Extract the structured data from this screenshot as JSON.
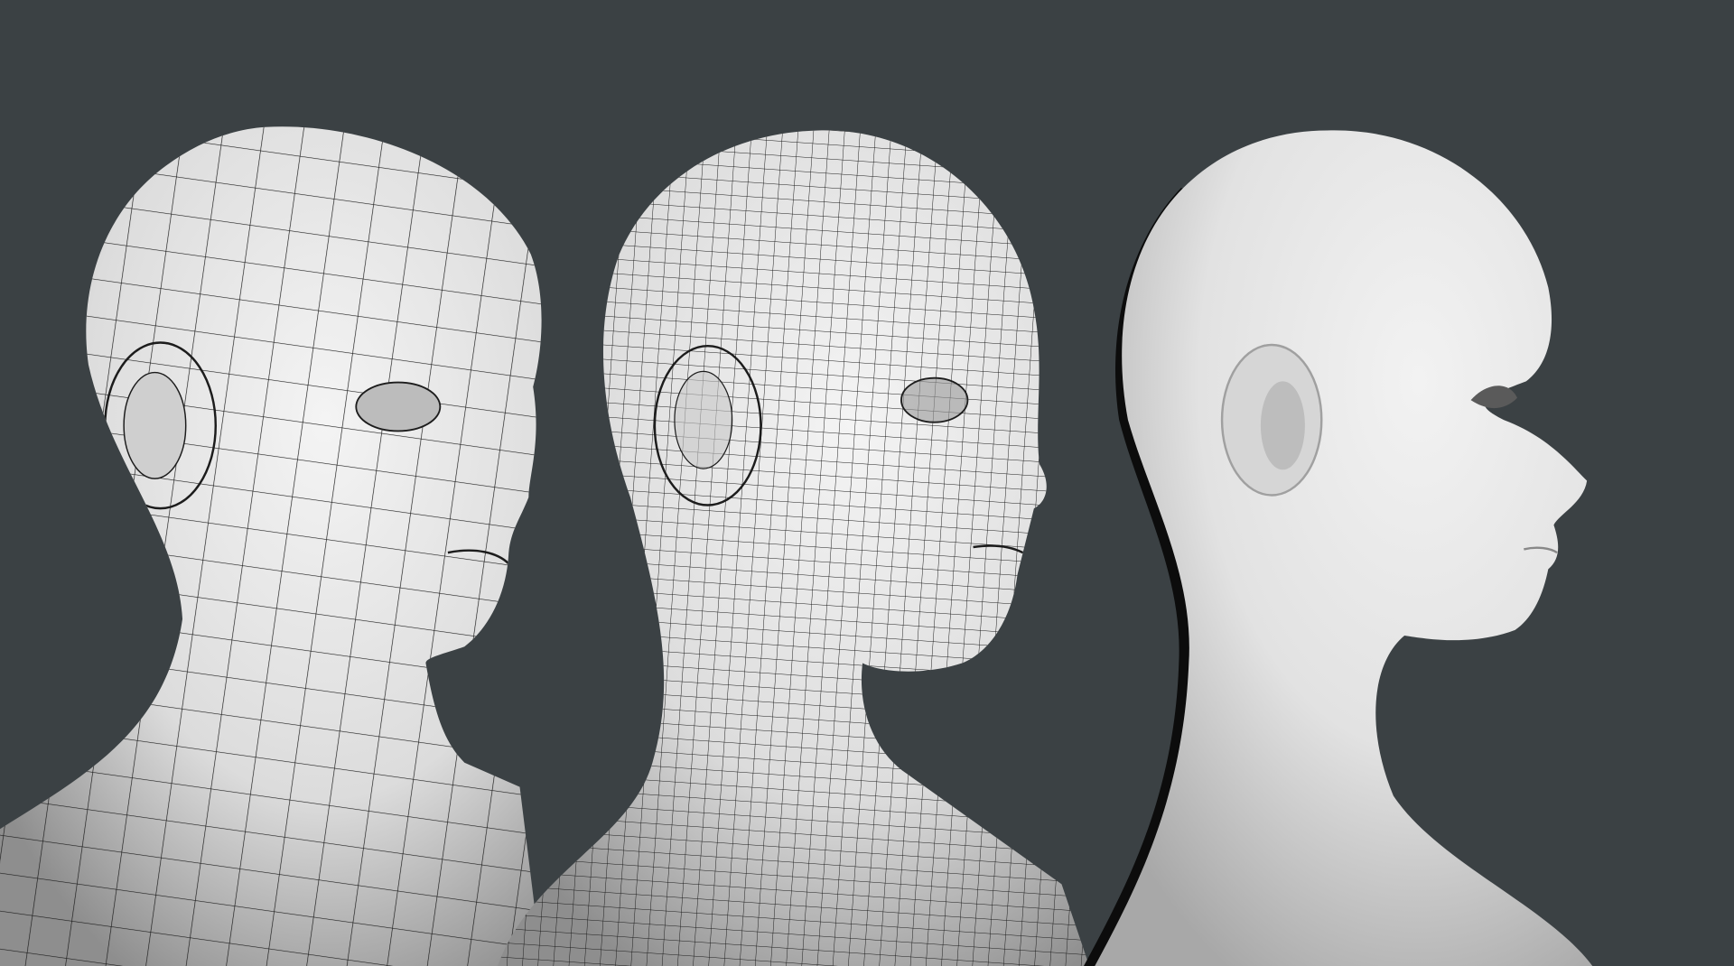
{
  "colors": {
    "background": "#3b4144",
    "mesh_light": "#f0f0f0",
    "mesh_dark": "#9a9a9a",
    "wire": "#1c1c1c"
  }
}
